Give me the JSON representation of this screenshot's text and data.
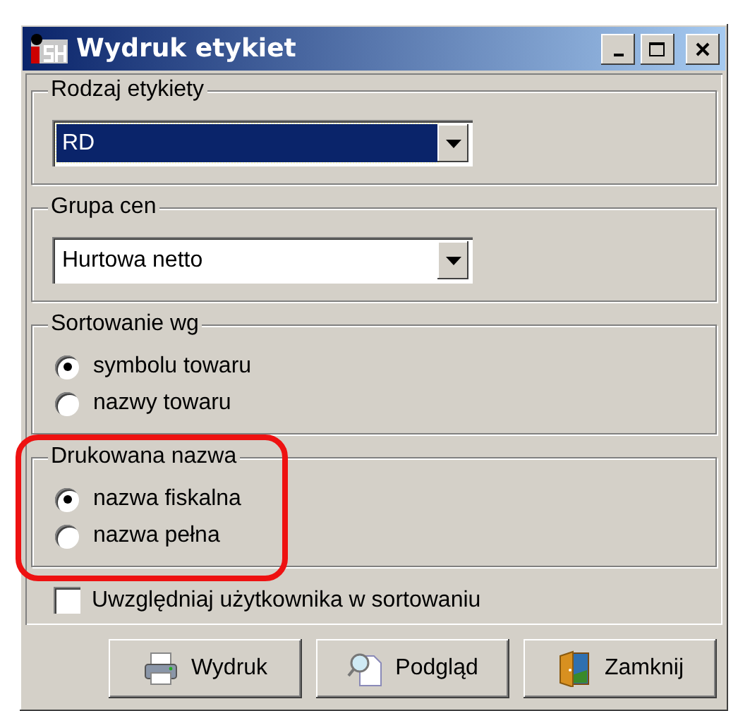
{
  "window": {
    "title": "Wydruk etykiet"
  },
  "groups": [
    {
      "kind": "combo",
      "title": "Rodzaj etykiety",
      "value": "RD",
      "focused": true,
      "highlighted": false
    },
    {
      "kind": "combo",
      "title": "Grupa cen",
      "value": "Hurtowa netto",
      "focused": false,
      "highlighted": false
    },
    {
      "kind": "radios",
      "title": "Sortowanie wg",
      "highlighted": false,
      "options": [
        {
          "label": "symbolu towaru",
          "selected": true
        },
        {
          "label": "nazwy towaru",
          "selected": false
        }
      ]
    },
    {
      "kind": "radios",
      "title": "Drukowana nazwa",
      "highlighted": true,
      "options": [
        {
          "label": "nazwa fiskalna",
          "selected": true
        },
        {
          "label": "nazwa pełna",
          "selected": false
        }
      ]
    }
  ],
  "checkbox": {
    "label": "Uwzględniaj użytkownika w sortowaniu",
    "checked": false
  },
  "buttons": [
    {
      "kind": "print",
      "label": "Wydruk"
    },
    {
      "kind": "preview",
      "label": "Podgląd"
    },
    {
      "kind": "close",
      "label": "Zamknij"
    }
  ]
}
